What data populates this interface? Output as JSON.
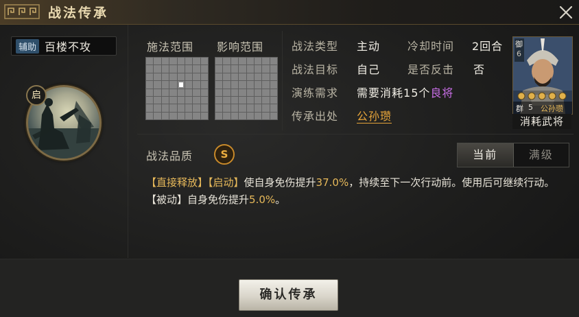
{
  "window": {
    "title": "战法传承"
  },
  "left": {
    "tag_badge": "辅助",
    "tag_name": "百楼不攻",
    "skill_badge": "启"
  },
  "ranges": {
    "cast_label": "施法范围",
    "effect_label": "影响范围"
  },
  "info": {
    "type_label": "战法类型",
    "type_value": "主动",
    "cooldown_label": "冷却时间",
    "cooldown_value": "2回合",
    "target_label": "战法目标",
    "target_value": "自己",
    "counter_label": "是否反击",
    "counter_value": "否",
    "drill_label": "演练需求",
    "drill_prefix": "需要消耗",
    "drill_count": "15个",
    "drill_grade": "良将",
    "origin_label": "传承出处",
    "origin_value": "公孙瓒"
  },
  "hero": {
    "faction": "群",
    "cost": "5",
    "name_small": "公孙瓒",
    "role_tag": "御",
    "role_level": "6",
    "caption": "消耗武将",
    "stars": 5
  },
  "quality": {
    "label": "战法品质",
    "grade": "S"
  },
  "toggle": {
    "current": "当前",
    "max": "满级"
  },
  "description": {
    "tag1": "【直接释放】",
    "tag2": "【启动】",
    "line1_text_a": "使自身免伤提升",
    "line1_value": "37.0%",
    "line1_text_b": "，持续至下一次行动前。使用后可继续行动。",
    "tag3": "【被动】",
    "line2_text_a": "自身免伤提升",
    "line2_value": "5.0%",
    "line2_text_b": "。"
  },
  "confirm_button": "确认传承",
  "colors": {
    "accent_gold": "#e7b95a",
    "grade_purple": "#c86ee6",
    "origin_orange": "#e7a53a"
  }
}
